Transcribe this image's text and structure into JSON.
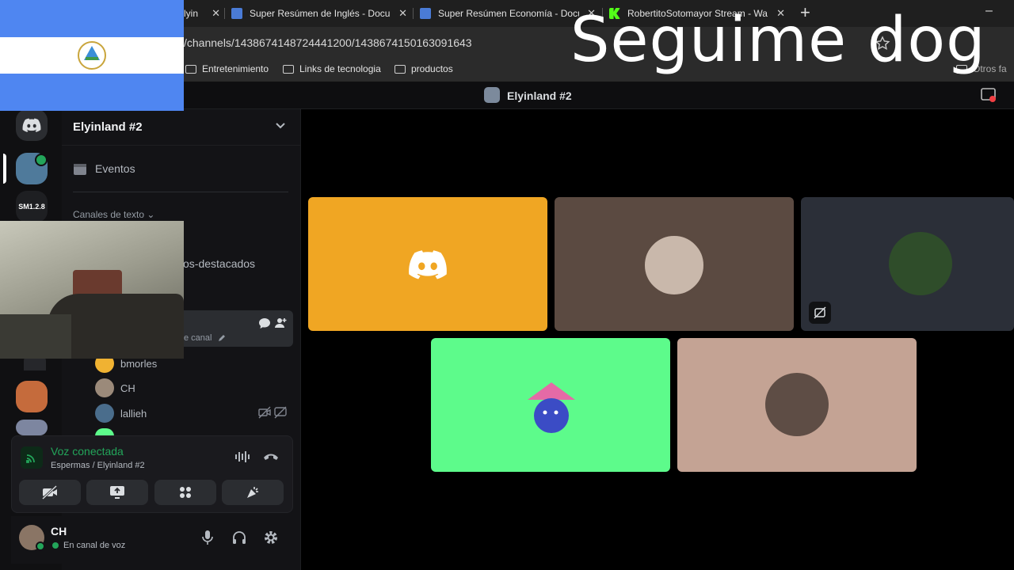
{
  "overlay": {
    "text": "Seguime dog"
  },
  "browser": {
    "tabs": [
      {
        "label": "lyin",
        "close": "✕"
      },
      {
        "label": "Super Resúmen de Inglés - Docu",
        "close": "✕"
      },
      {
        "label": "Super Resúmen Economía - Docu",
        "close": "✕"
      },
      {
        "label": "RobertitoSotomayor Stream - Wa",
        "close": "✕"
      }
    ],
    "new_tab": "+",
    "minimize": "–",
    "url": "/channels/1438674148724441200/1438674150163091643",
    "bookmarks": [
      "Entretenimiento",
      "Links de tecnologia",
      "productos"
    ],
    "other_bookmarks": "Otros fa"
  },
  "discord": {
    "window_title": "Elyinland #2",
    "server_name": "Elyinland #2",
    "server_rail": {
      "label": "SM1.2.8"
    },
    "events_label": "Eventos",
    "category_label": "Canales de texto",
    "channel_partial": "os-destacados",
    "voice_channel_hint": "e canal",
    "voice_members": [
      {
        "name": "bmorles"
      },
      {
        "name": "CH"
      },
      {
        "name": "lallieh"
      }
    ],
    "voice_status": {
      "title": "Voz conectada",
      "subtitle": "Espermas / Elyinland #2"
    },
    "user": {
      "name": "CH",
      "status": "En canal de voz"
    },
    "colors": {
      "green": "#57f287",
      "orange": "#f0a623",
      "brown": "#5b4a41",
      "slate": "#2b2f38",
      "mint": "#5dfb8b",
      "tan": "#c4a394"
    }
  }
}
